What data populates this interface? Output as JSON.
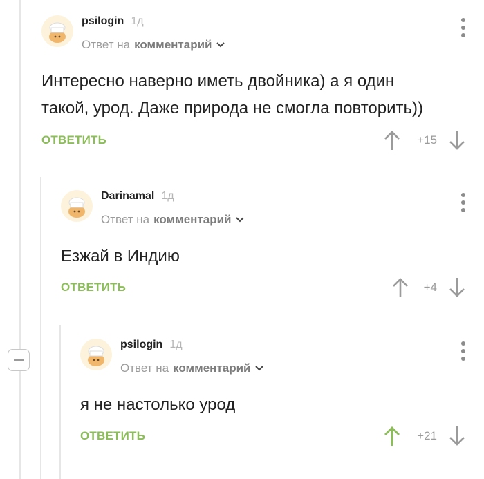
{
  "comments": [
    {
      "author": "psilogin",
      "time": "1д",
      "reply_prefix": "Ответ на",
      "reply_link": "комментарий",
      "text_lines": [
        "Интересно наверно иметь двойника)  а я один",
        "такой, урод. Даже природа не смогла повторить))"
      ],
      "reply_button": "ОТВЕТИТЬ",
      "score": "+15",
      "upvoted": false
    },
    {
      "author": "Darinamal",
      "time": "1д",
      "reply_prefix": "Ответ на",
      "reply_link": "комментарий",
      "text_lines": [
        "Езжай в Индию"
      ],
      "reply_button": "ОТВЕТИТЬ",
      "score": "+4",
      "upvoted": false
    },
    {
      "author": "psilogin",
      "time": "1д",
      "reply_prefix": "Ответ на",
      "reply_link": "комментарий",
      "text_lines": [
        "я не настолько урод"
      ],
      "reply_button": "ОТВЕТИТЬ",
      "score": "+21",
      "upvoted": true
    }
  ],
  "colors": {
    "accent_green": "#8cbd5a",
    "vote_gray": "#9b9b9b",
    "avatar_bg": "#fdf3dc",
    "avatar_hat": "#ffffff",
    "avatar_face": "#f0b66b"
  },
  "icons": {
    "collapse": "minus-icon",
    "menu": "more-vertical-icon",
    "upvote": "arrow-up-icon",
    "downvote": "arrow-down-icon",
    "chevron": "chevron-down-icon",
    "avatar": "chef-avatar-icon"
  }
}
